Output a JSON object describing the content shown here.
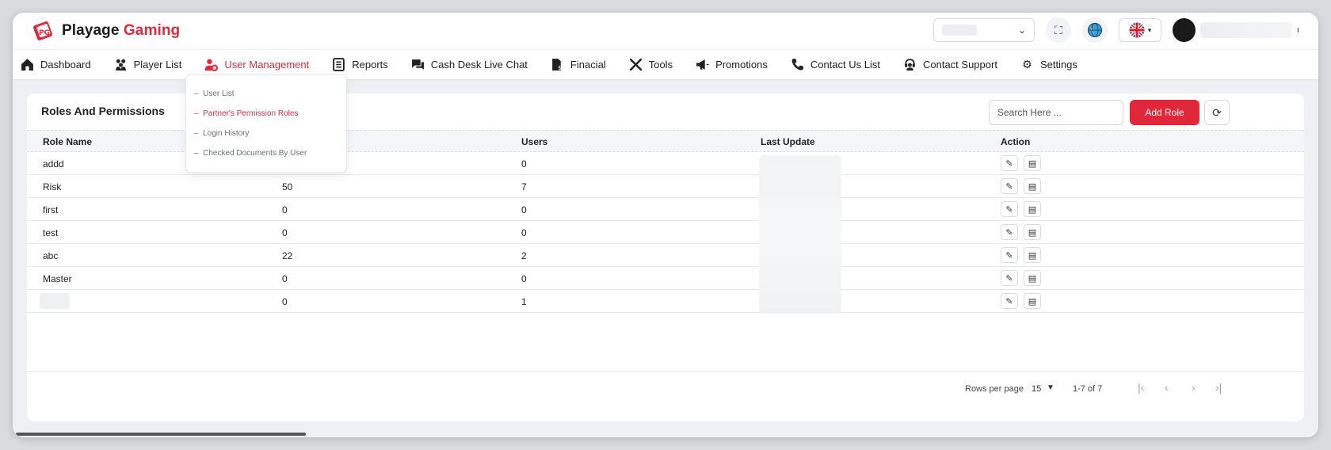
{
  "brand": {
    "name_part1": "Playage",
    "name_part2": "Gaming",
    "accent_color": "#e02a3b"
  },
  "header": {
    "fullscreen_icon": "expand-icon",
    "globe_icon": "globe-icon",
    "language_flag": "uk-flag-icon"
  },
  "nav": {
    "items": [
      {
        "label": "Dashboard",
        "icon": "home-icon"
      },
      {
        "label": "Player List",
        "icon": "users-icon"
      },
      {
        "label": "User Management",
        "icon": "user-gear-icon",
        "active": true
      },
      {
        "label": "Reports",
        "icon": "report-icon"
      },
      {
        "label": "Cash Desk Live Chat",
        "icon": "chat-icon"
      },
      {
        "label": "Finacial",
        "icon": "finance-icon"
      },
      {
        "label": "Tools",
        "icon": "tools-icon"
      },
      {
        "label": "Promotions",
        "icon": "megaphone-icon"
      },
      {
        "label": "Contact Us List",
        "icon": "phone-icon"
      },
      {
        "label": "Contact Support",
        "icon": "support-icon"
      },
      {
        "label": "Settings",
        "icon": "gear-icon"
      }
    ]
  },
  "submenu": {
    "items": [
      {
        "label": "User List",
        "active": false
      },
      {
        "label": "Partner's Permission Roles",
        "active": true
      },
      {
        "label": "Login History",
        "active": false
      },
      {
        "label": "Checked Documents By User",
        "active": false
      }
    ]
  },
  "card": {
    "title": "Roles And Permissions",
    "search_placeholder": "Search Here ...",
    "add_label": "Add Role"
  },
  "table": {
    "headers": [
      "Role Name",
      "",
      "Users",
      "Last Update",
      "Action"
    ],
    "rows": [
      {
        "name": "addd",
        "count": "",
        "users": "0"
      },
      {
        "name": "Risk",
        "count": "50",
        "users": "7"
      },
      {
        "name": "first",
        "count": "0",
        "users": "0"
      },
      {
        "name": "test",
        "count": "0",
        "users": "0"
      },
      {
        "name": "abc",
        "count": "22",
        "users": "2"
      },
      {
        "name": "Master",
        "count": "0",
        "users": "0"
      },
      {
        "name": "",
        "count": "0",
        "users": "1"
      }
    ]
  },
  "pagination": {
    "rows_per_page_label": "Rows per page",
    "rows_per_page_value": "15",
    "range": "1-7 of 7"
  }
}
